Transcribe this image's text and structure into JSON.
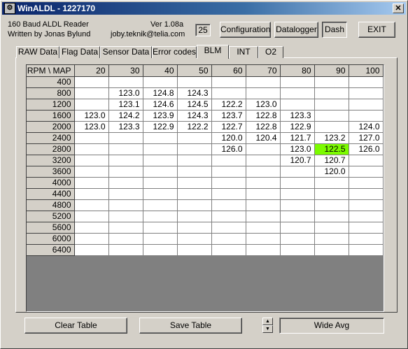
{
  "window": {
    "title": "WinALDL - 1227170",
    "close": "✕"
  },
  "info": {
    "line1": "160 Baud ALDL Reader",
    "line2": "Written by Jonas Bylund",
    "version": "Ver 1.08a",
    "email": "joby.teknik@telia.com"
  },
  "counter": "25",
  "buttons": {
    "configuration": "Configuration",
    "datalogger": "Datalogger",
    "dash": "Dash",
    "exit": "EXIT",
    "clear_table": "Clear Table",
    "save_table": "Save Table",
    "wide_avg": "Wide Avg"
  },
  "tabs": [
    "RAW Data",
    "Flag Data",
    "Sensor Data",
    "Error codes",
    "BLM",
    "INT",
    "O2"
  ],
  "active_tab": "BLM",
  "table": {
    "corner": "RPM \\ MAP",
    "columns": [
      "20",
      "30",
      "40",
      "50",
      "60",
      "70",
      "80",
      "90",
      "100"
    ],
    "rows": [
      {
        "rpm": "400",
        "cells": [
          "",
          "",
          "",
          "",
          "",
          "",
          "",
          "",
          ""
        ]
      },
      {
        "rpm": "800",
        "cells": [
          "",
          "123.0",
          "124.8",
          "124.3",
          "",
          "",
          "",
          "",
          ""
        ]
      },
      {
        "rpm": "1200",
        "cells": [
          "",
          "123.1",
          "124.6",
          "124.5",
          "122.2",
          "123.0",
          "",
          "",
          ""
        ]
      },
      {
        "rpm": "1600",
        "cells": [
          "123.0",
          "124.2",
          "123.9",
          "124.3",
          "123.7",
          "122.8",
          "123.3",
          "",
          ""
        ]
      },
      {
        "rpm": "2000",
        "cells": [
          "123.0",
          "123.3",
          "122.9",
          "122.2",
          "122.7",
          "122.8",
          "122.9",
          "",
          "124.0"
        ]
      },
      {
        "rpm": "2400",
        "cells": [
          "",
          "",
          "",
          "",
          "120.0",
          "120.4",
          "121.7",
          "123.2",
          "127.0"
        ]
      },
      {
        "rpm": "2800",
        "cells": [
          "",
          "",
          "",
          "",
          "126.0",
          "",
          "123.0",
          "122.5",
          "126.0"
        ]
      },
      {
        "rpm": "3200",
        "cells": [
          "",
          "",
          "",
          "",
          "",
          "",
          "120.7",
          "120.7",
          ""
        ]
      },
      {
        "rpm": "3600",
        "cells": [
          "",
          "",
          "",
          "",
          "",
          "",
          "",
          "120.0",
          ""
        ]
      },
      {
        "rpm": "4000",
        "cells": [
          "",
          "",
          "",
          "",
          "",
          "",
          "",
          "",
          ""
        ]
      },
      {
        "rpm": "4400",
        "cells": [
          "",
          "",
          "",
          "",
          "",
          "",
          "",
          "",
          ""
        ]
      },
      {
        "rpm": "4800",
        "cells": [
          "",
          "",
          "",
          "",
          "",
          "",
          "",
          "",
          ""
        ]
      },
      {
        "rpm": "5200",
        "cells": [
          "",
          "",
          "",
          "",
          "",
          "",
          "",
          "",
          ""
        ]
      },
      {
        "rpm": "5600",
        "cells": [
          "",
          "",
          "",
          "",
          "",
          "",
          "",
          "",
          ""
        ]
      },
      {
        "rpm": "6000",
        "cells": [
          "",
          "",
          "",
          "",
          "",
          "",
          "",
          "",
          ""
        ]
      },
      {
        "rpm": "6400",
        "cells": [
          "",
          "",
          "",
          "",
          "",
          "",
          "",
          "",
          ""
        ]
      }
    ],
    "highlight": {
      "rpm": "2800",
      "map": "90",
      "color": "#7cfc00"
    }
  },
  "colors": {
    "titlebar": "#0a246a",
    "face": "#d4d0c8",
    "grid_empty": "#808080"
  }
}
